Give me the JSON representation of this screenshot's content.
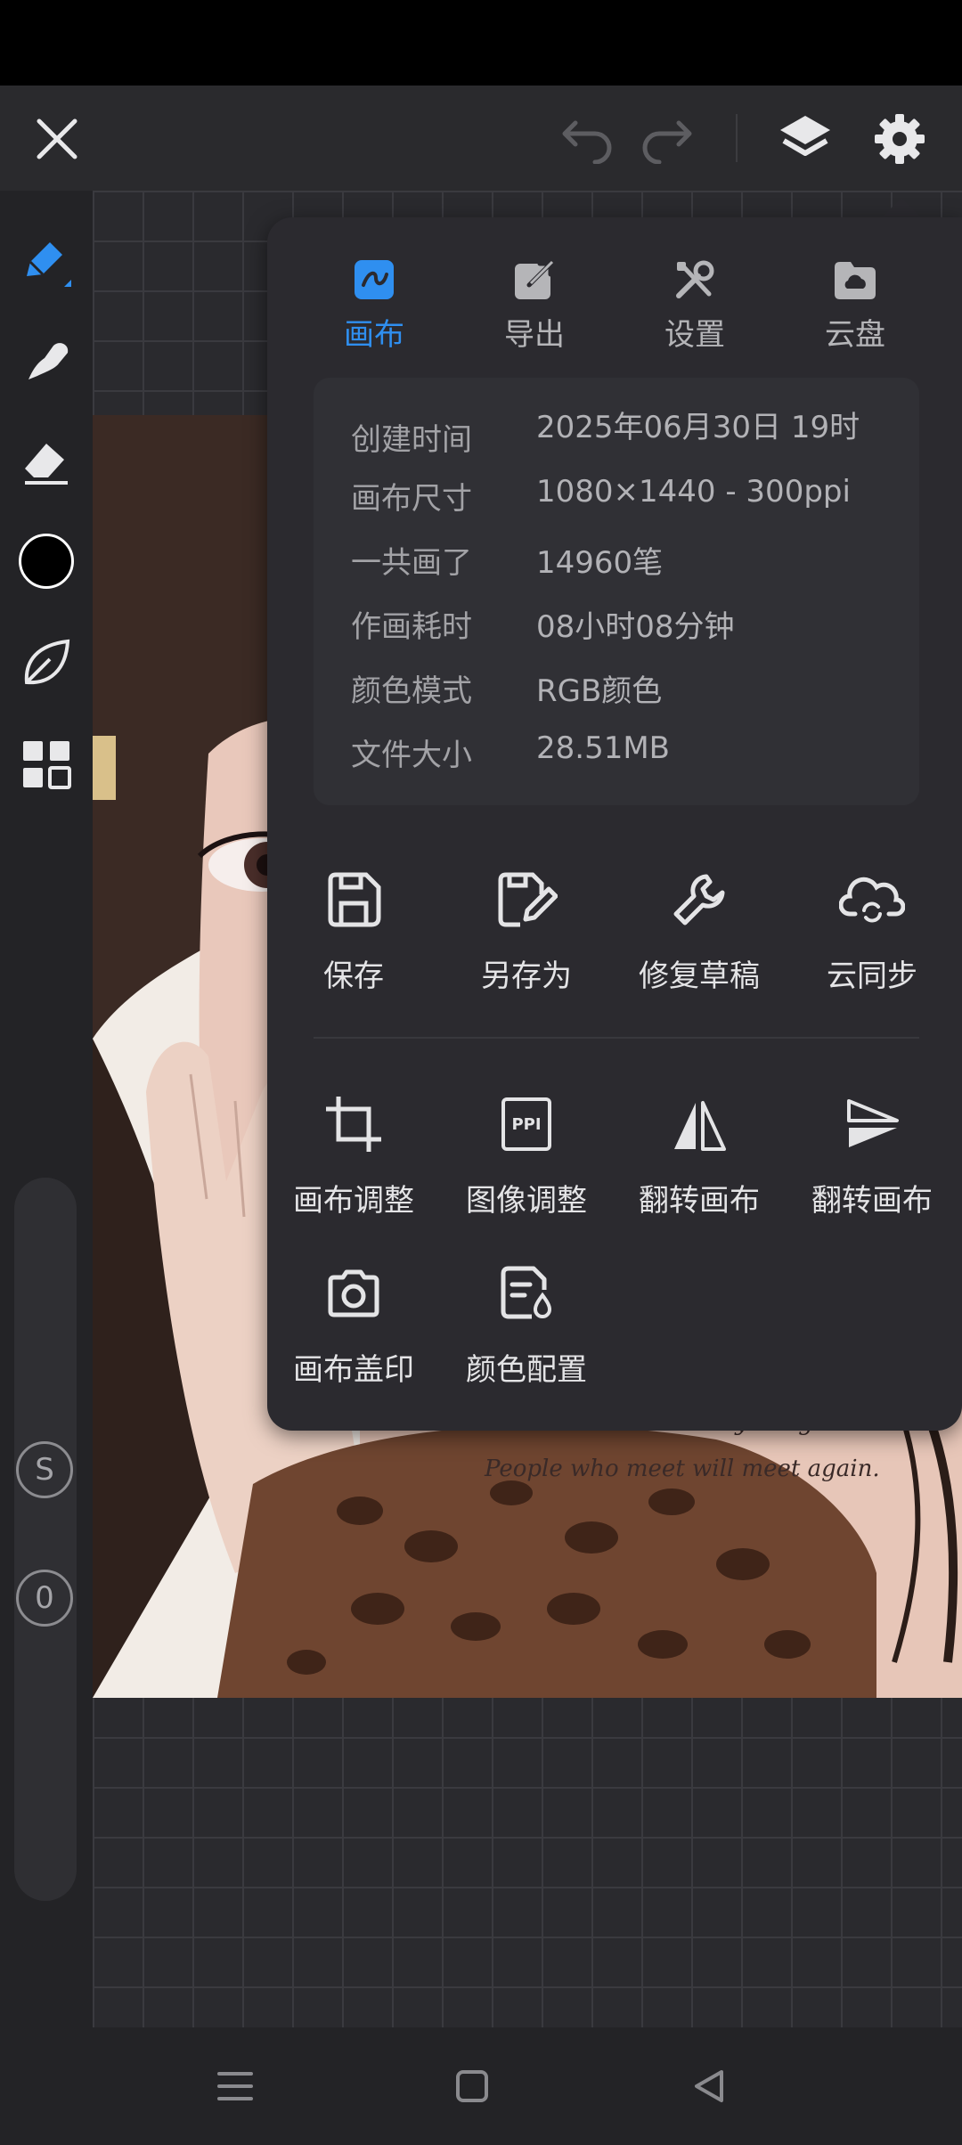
{
  "toolbar": {
    "close": "close-icon",
    "undo": "undo-icon",
    "redo": "redo-icon",
    "layers": "layers-icon",
    "settings": "gear-icon"
  },
  "left_tools": {
    "brush_size_badge": "S",
    "opacity_badge": "0"
  },
  "artwork": {
    "quote_line1": "Someone will be with you again.",
    "quote_line2": "People who meet will meet again."
  },
  "popup": {
    "tabs": [
      {
        "label": "画布",
        "active": true
      },
      {
        "label": "导出",
        "active": false
      },
      {
        "label": "设置",
        "active": false
      },
      {
        "label": "云盘",
        "active": false
      }
    ],
    "info": [
      {
        "key": "创建时间",
        "value": "2025年06月30日 19时"
      },
      {
        "key": "画布尺寸",
        "value": "1080×1440 - 300ppi"
      },
      {
        "key": "一共画了",
        "value": "14960笔"
      },
      {
        "key": "作画耗时",
        "value": "08小时08分钟"
      },
      {
        "key": "颜色模式",
        "value": "RGB颜色"
      },
      {
        "key": "文件大小",
        "value": "28.51MB"
      }
    ],
    "actions_row1": [
      {
        "label": "保存"
      },
      {
        "label": "另存为"
      },
      {
        "label": "修复草稿"
      },
      {
        "label": "云同步"
      }
    ],
    "actions_row2": [
      {
        "label": "画布调整"
      },
      {
        "label": "图像调整"
      },
      {
        "label": "翻转画布"
      },
      {
        "label": "翻转画布"
      }
    ],
    "actions_row3": [
      {
        "label": "画布盖印"
      },
      {
        "label": "颜色配置"
      }
    ],
    "ppi_icon_text": "PPI"
  },
  "colors": {
    "accent": "#2f8ff0",
    "panel": "#2b2a2f",
    "toolbar": "#2a2a2d"
  }
}
